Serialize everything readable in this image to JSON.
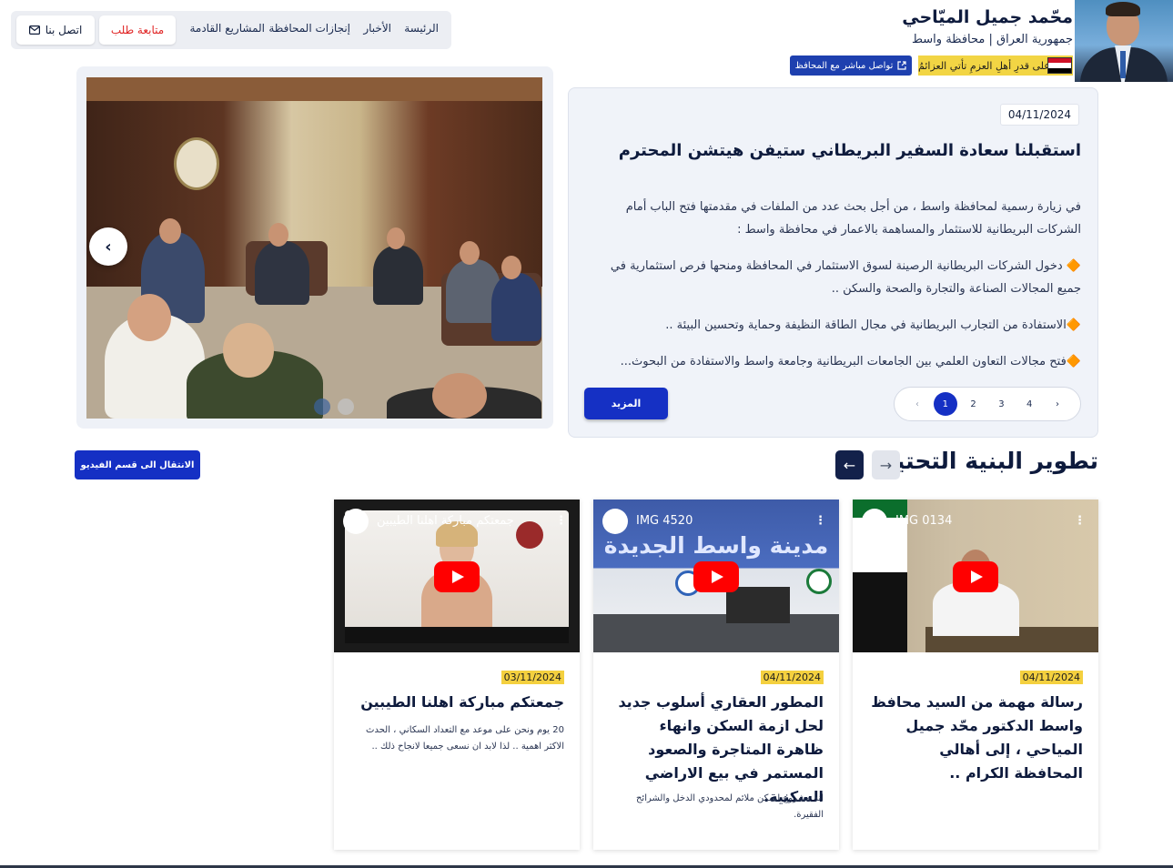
{
  "header": {
    "name": "محّمد جميل الميّاحي",
    "region": "جمهورية العراق | محافظة واسط",
    "slogan": "على قدرِ أهلِ العزمِ تأتي العزائمُ",
    "contact_governor": "تواصل مباشر مع المحافظ"
  },
  "nav": {
    "links": [
      "الرئيسة",
      "الأخبار",
      "إنجازات المحافظة",
      "المشاريع القادمة"
    ],
    "track_request": "متابعة طلب",
    "contact_us": "اتصل بنا"
  },
  "news": {
    "date": "04/11/2024",
    "title": "استقبلنا سعادة السفير البريطاني ستيفن هيتشن المحترم",
    "paragraphs": [
      "في زيارة رسمية لمحافظة واسط ، من أجل بحث عدد من الملفات في مقدمتها فتح الباب أمام الشركات البريطانية للاستثمار والمساهمة بالاعمار في محافظة واسط :",
      "دخول الشركات البريطانية الرصينة لسوق الاستثمار في المحافظة ومنحها فرص استثمارية في جميع المجالات الصناعة والتجارة والصحة والسكن ..",
      "الاستفادة من التجارب البريطانية في مجال الطاقة النظيفة وحماية وتحسين البيئة ..",
      "فتح مجالات التعاون العلمي بين الجامعات البريطانية وجامعة واسط والاستفادة من البحوث..."
    ],
    "bullet": "🔶",
    "pages": [
      "1",
      "2",
      "3",
      "4"
    ],
    "prev": "‹",
    "next": "›",
    "more": "المزيد"
  },
  "slider": {
    "arrow": "›",
    "slides": 2,
    "active": 1
  },
  "infrastructure": {
    "title": "تطوير البنية التحتية",
    "video_link": "الانتقال الى قسم الفيديو",
    "prev": "→",
    "next": "←",
    "cards": [
      {
        "video_title": "IMG 0134",
        "date": "04/11/2024",
        "title": "رسالة مهمة من السيد محافظ واسط الدكتور محّد جميل المياحي ، إلى أهالي المحافظة الكرام ..",
        "desc": ""
      },
      {
        "video_title": "IMG 4520",
        "date": "04/11/2024",
        "title": "المطور العقاري أسلوب جديد لحل ازمة السكن وانهاء ظاهرة المتاجرة والصعود المستمر في بيع الاراضي السكنية.",
        "desc": "انه مشروع لسكن ملائم لمحدودي الدخل والشرائح الفقيرة."
      },
      {
        "video_title": "جمعتكم مباركة اهلنا الطيبين",
        "date": "03/11/2024",
        "title": "جمعتكم مباركة اهلنا الطيبين",
        "desc": "20 يوم ونحن على موعد مع التعداد السكاني ، الحدث الاكثر اهمية .. لذا لابد ان نسعى جميعا لانجاح ذلك .."
      }
    ]
  },
  "colors": {
    "primary": "#1530c4",
    "navy": "#0e1b3d",
    "accent": "#f4d03f",
    "youtube": "#ff0000"
  }
}
